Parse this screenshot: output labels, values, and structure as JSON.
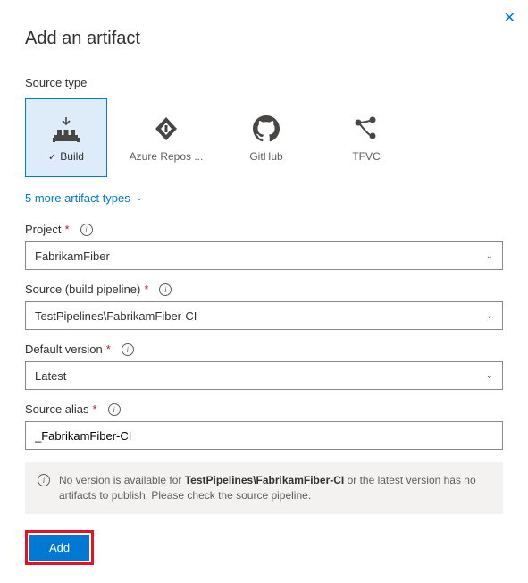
{
  "header": {
    "title": "Add an artifact"
  },
  "sourceType": {
    "label": "Source type",
    "options": {
      "build": "Build",
      "azureRepos": "Azure Repos ...",
      "github": "GitHub",
      "tfvc": "TFVC"
    },
    "moreLink": "5 more artifact types"
  },
  "fields": {
    "project": {
      "label": "Project",
      "value": "FabrikamFiber"
    },
    "source": {
      "label": "Source (build pipeline)",
      "value": "TestPipelines\\FabrikamFiber-CI"
    },
    "defaultVersion": {
      "label": "Default version",
      "value": "Latest"
    },
    "sourceAlias": {
      "label": "Source alias",
      "value": "_FabrikamFiber-CI"
    }
  },
  "infoMessage": {
    "prefix": "No version is available for ",
    "bold": "TestPipelines\\FabrikamFiber-CI",
    "suffix": " or the latest version has no artifacts to publish. Please check the source pipeline."
  },
  "actions": {
    "add": "Add"
  }
}
